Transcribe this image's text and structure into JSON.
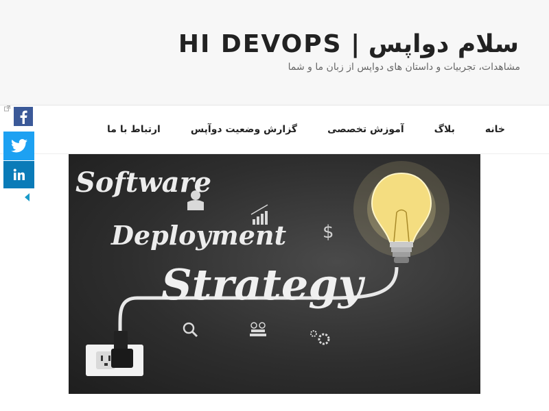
{
  "site": {
    "title": "سلام دواپس | HI DEVOPS",
    "description": "مشاهدات، تجربیات و داستان های دواپس از زبان ما و شما"
  },
  "nav": {
    "items": [
      "خانه",
      "بلاگ",
      "آموزش تخصصی",
      "گزارش وضعیت دوآپس",
      "ارتباط با ما"
    ]
  },
  "social": {
    "buttons": [
      "facebook-icon",
      "twitter-icon",
      "linkedin-icon"
    ],
    "colors": {
      "facebook": "#3b5998",
      "twitter": "#1da1f2",
      "linkedin": "#0a7bb8"
    }
  },
  "hero": {
    "line1": "Software",
    "line2": "Deployment",
    "line3": "Strategy"
  }
}
